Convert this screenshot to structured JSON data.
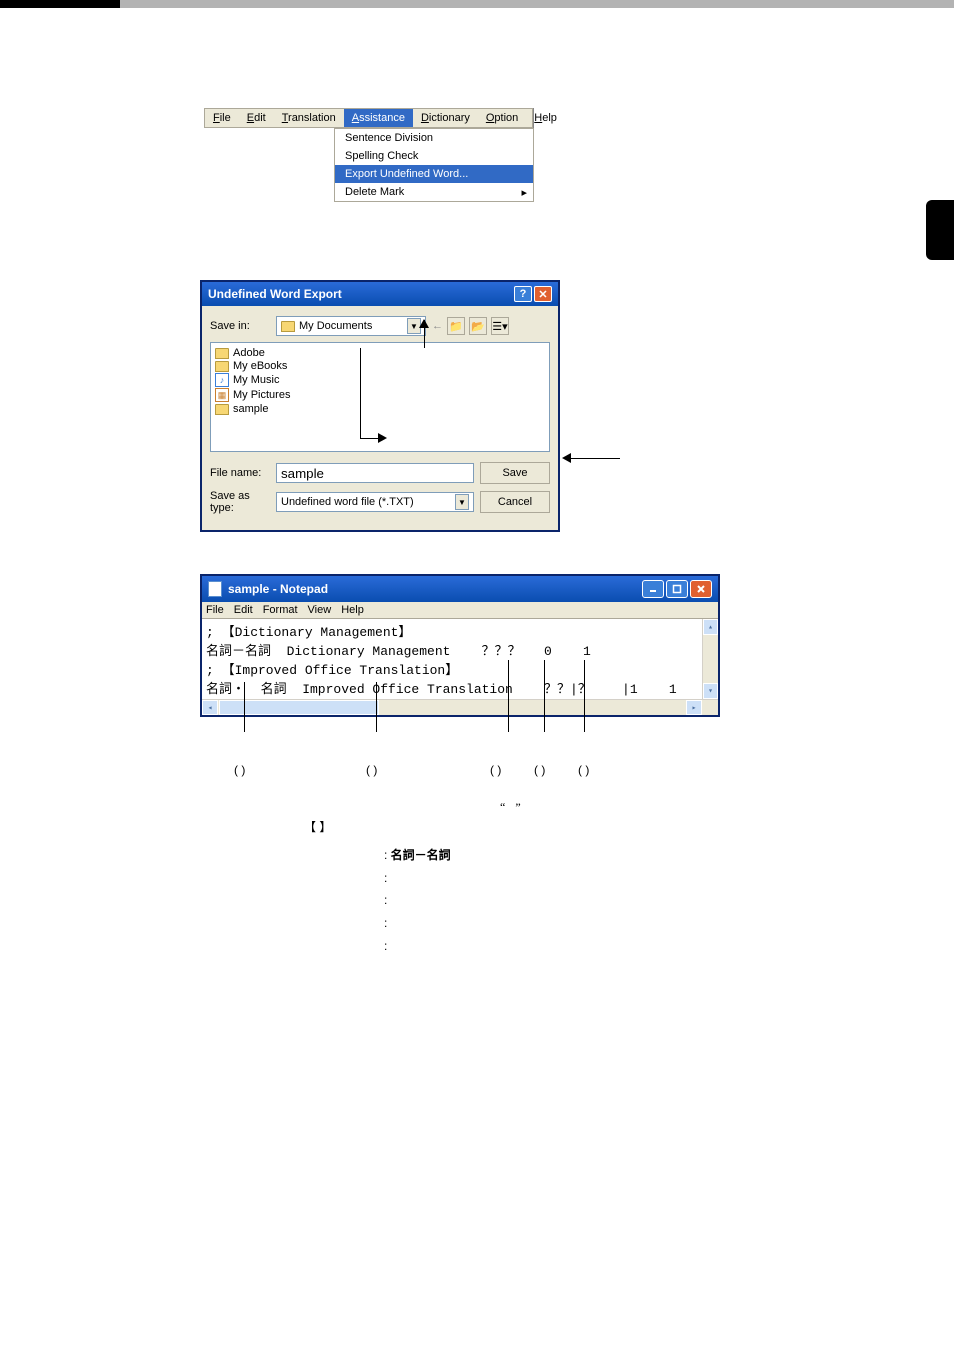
{
  "menu": {
    "items": [
      "File",
      "Edit",
      "Translation",
      "Assistance",
      "Dictionary",
      "Option",
      "Help"
    ],
    "active": "Assistance",
    "submenu": {
      "items": [
        {
          "label": "Sentence Division",
          "arrow": false
        },
        {
          "label": "Spelling Check",
          "arrow": false
        },
        {
          "label": "Export Undefined Word...",
          "arrow": false,
          "highlight": true
        },
        {
          "label": "Delete Mark",
          "arrow": true
        }
      ]
    }
  },
  "dialog": {
    "title": "Undefined Word Export",
    "save_in_label": "Save in:",
    "save_in_value": "My Documents",
    "files": [
      "Adobe",
      "My eBooks",
      "My Music",
      "My Pictures",
      "sample"
    ],
    "file_name_label": "File name:",
    "file_name_value": "sample",
    "save_as_type_label": "Save as type:",
    "save_as_type_value": "Undefined word file (*.TXT)",
    "save_button": "Save",
    "cancel_button": "Cancel"
  },
  "notepad": {
    "title": "sample - Notepad",
    "menu": [
      "File",
      "Edit",
      "Format",
      "View",
      "Help"
    ],
    "lines": [
      "; 【Dictionary Management】",
      "名詞－名詞  Dictionary Management    ？？？   0    1",
      "; 【Improved Office Translation】",
      "名詞・  名詞  Improved Office Translation    ？？|？    |1    1"
    ]
  },
  "callouts": {
    "a": "(  )",
    "b": "(  )",
    "c": "(  )",
    "d": "(  )",
    "e": "(  )"
  },
  "notes": {
    "row1_left": "",
    "row1_mid": "“",
    "row1_right": "”",
    "row2": "【 】",
    "list": [
      {
        "label": "",
        "sep": ": ",
        "value": "名詞－名詞"
      },
      {
        "label": "",
        "sep": ":",
        "value": ""
      },
      {
        "label": "",
        "sep": ":",
        "value": ""
      },
      {
        "label": "",
        "sep": ":",
        "value": ""
      },
      {
        "label": "",
        "sep": ":",
        "value": ""
      }
    ]
  }
}
